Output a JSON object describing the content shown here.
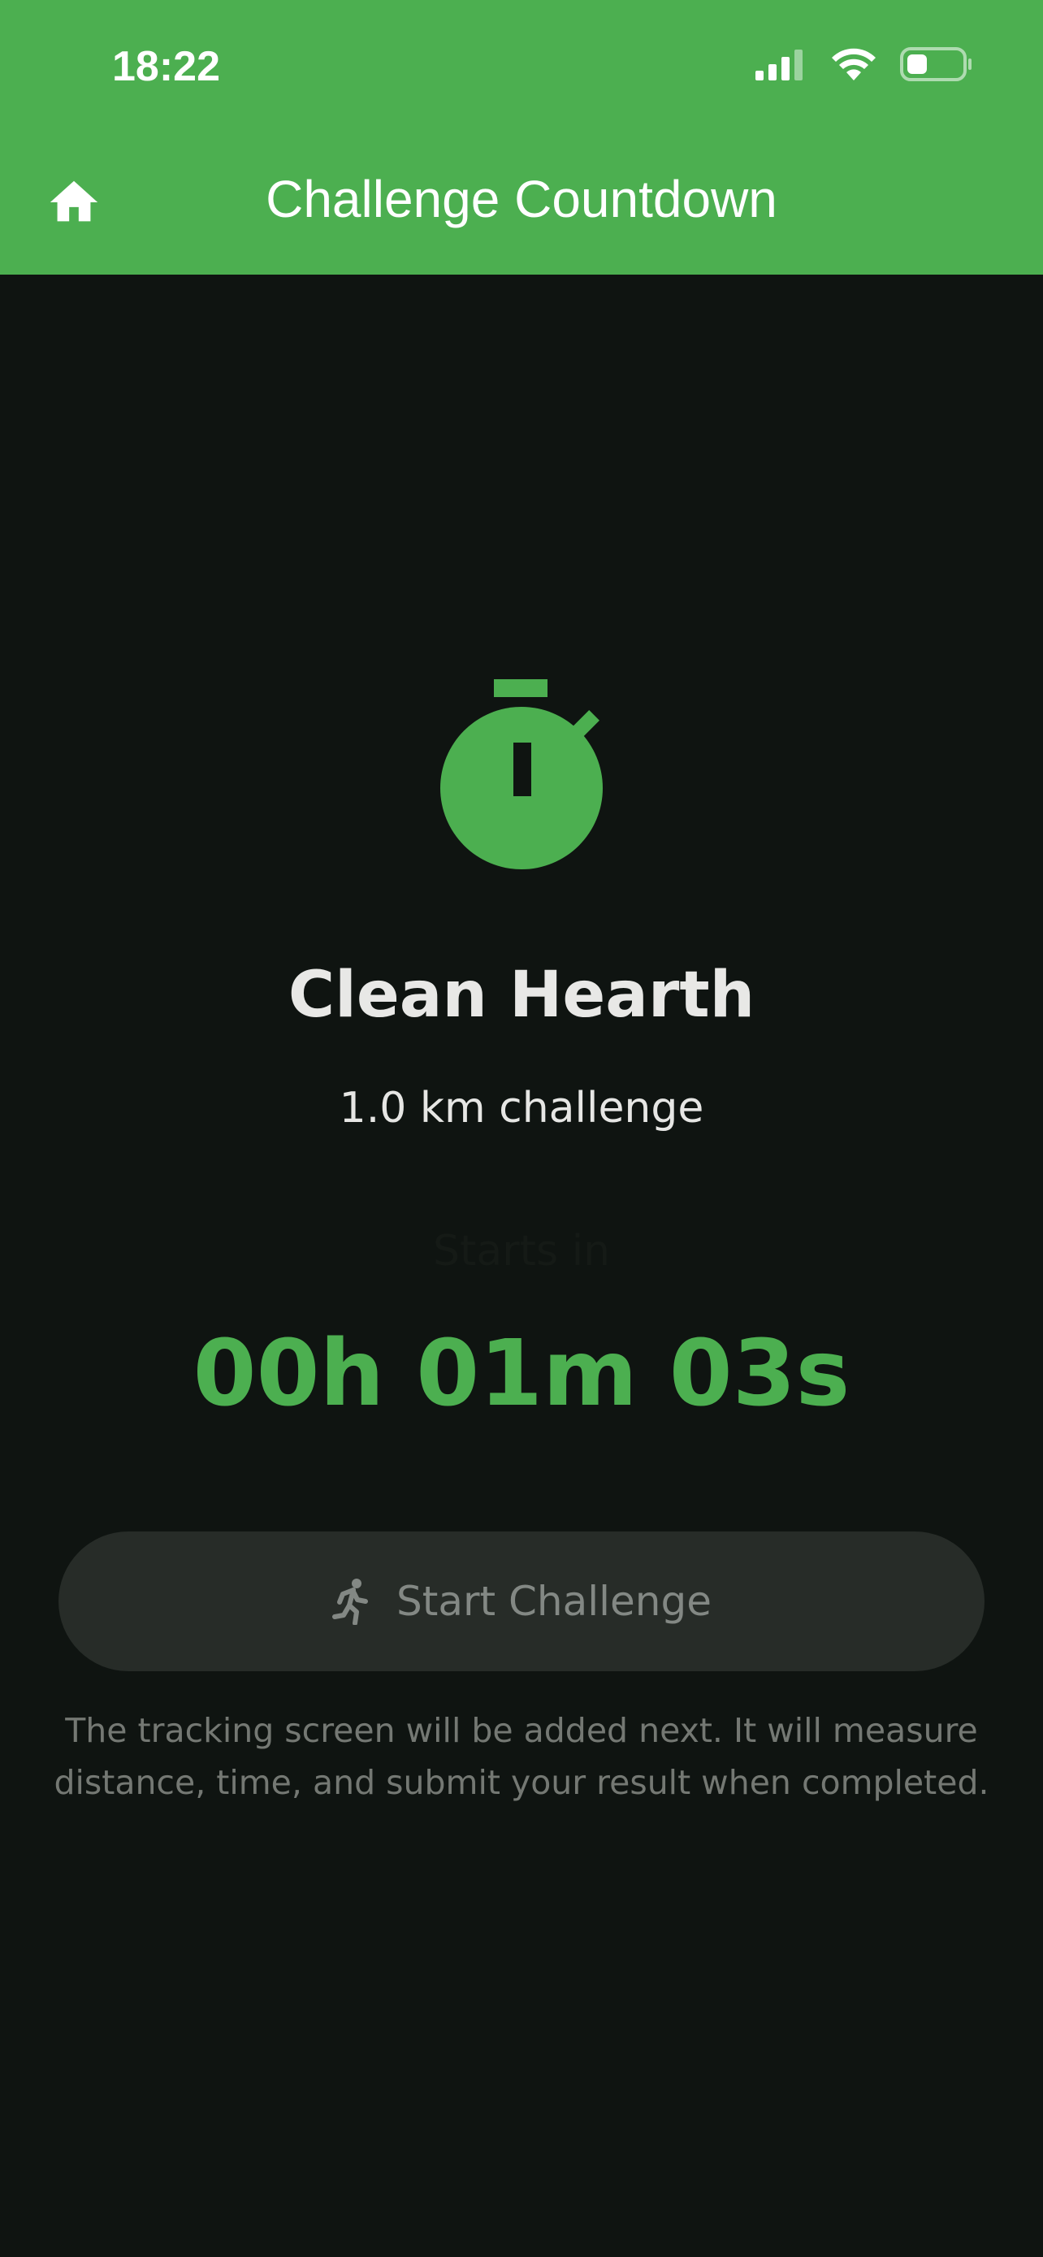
{
  "status_bar": {
    "time": "18:22",
    "icons": [
      "cellular-signal-icon",
      "wifi-icon",
      "battery-icon"
    ]
  },
  "app_bar": {
    "title": "Challenge Countdown",
    "home_icon": "home-icon"
  },
  "challenge": {
    "icon": "stopwatch-icon",
    "name": "Clean Hearth",
    "distance": "1.0 km challenge",
    "starts_in_label": "Starts in",
    "countdown": "00h 01m 03s"
  },
  "start_button": {
    "label": "Start Challenge",
    "icon": "runner-icon",
    "enabled": false
  },
  "info": {
    "text": "The tracking screen will be added next. It will measure distance, time, and submit your result when completed."
  },
  "colors": {
    "accent": "#4caf50",
    "background": "#0f1411",
    "button_disabled": "#272c28"
  }
}
